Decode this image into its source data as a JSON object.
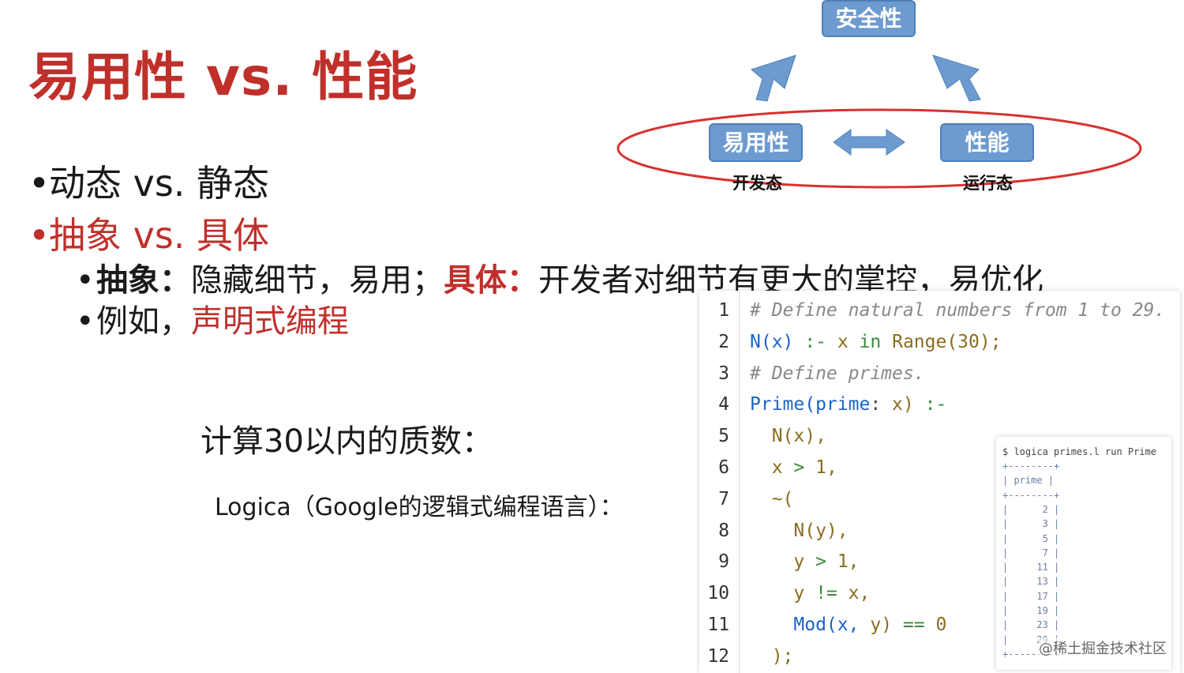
{
  "title": "易用性 vs. 性能",
  "bullets": {
    "b1": "动态 vs. 静态",
    "b2": "抽象 vs. 具体",
    "b3_label1": "抽象：",
    "b3_text1": "隐藏细节，易用；",
    "b3_label2": "具体：",
    "b3_text2": "开发者对细节有更大的掌控，易优化",
    "b4_text": "例如，",
    "b4_red": "声明式编程"
  },
  "calc_text": "计算30以内的质数：",
  "logica_text": "Logica（Google的逻辑式编程语言）：",
  "diagram": {
    "top_node": "安全性",
    "left_node": "易用性",
    "right_node": "性能",
    "left_state": "开发态",
    "right_state": "运行态",
    "node_color": "#6d9bd0",
    "ellipse_color": "#d8322e"
  },
  "code": {
    "lines": [
      {
        "n": "1",
        "segs": [
          [
            "cm",
            "# Define natural numbers from 1 to 29."
          ]
        ]
      },
      {
        "n": "2",
        "segs": [
          [
            "fn",
            "N(x)"
          ],
          [
            "",
            " "
          ],
          [
            "op",
            ":-"
          ],
          [
            "",
            " "
          ],
          [
            "vr",
            "x"
          ],
          [
            "",
            " "
          ],
          [
            "op",
            "in"
          ],
          [
            "",
            " "
          ],
          [
            "vr",
            "Range(30);"
          ]
        ]
      },
      {
        "n": "3",
        "segs": [
          [
            "cm",
            "# Define primes."
          ]
        ]
      },
      {
        "n": "4",
        "segs": [
          [
            "fn",
            "Prime(prime"
          ],
          [
            "",
            ": "
          ],
          [
            "vr",
            "x)"
          ],
          [
            "",
            " "
          ],
          [
            "op",
            ":-"
          ]
        ]
      },
      {
        "n": "5",
        "segs": [
          [
            "",
            "  "
          ],
          [
            "vr",
            "N(x),"
          ]
        ]
      },
      {
        "n": "6",
        "segs": [
          [
            "",
            "  "
          ],
          [
            "vr",
            "x"
          ],
          [
            "",
            " "
          ],
          [
            "op",
            ">"
          ],
          [
            "",
            " "
          ],
          [
            "vr",
            "1,"
          ]
        ]
      },
      {
        "n": "7",
        "segs": [
          [
            "",
            "  "
          ],
          [
            "vr",
            "~("
          ]
        ]
      },
      {
        "n": "8",
        "segs": [
          [
            "",
            "    "
          ],
          [
            "vr",
            "N(y),"
          ]
        ]
      },
      {
        "n": "9",
        "segs": [
          [
            "",
            "    "
          ],
          [
            "vr",
            "y"
          ],
          [
            "",
            " "
          ],
          [
            "op",
            ">"
          ],
          [
            "",
            " "
          ],
          [
            "vr",
            "1,"
          ]
        ]
      },
      {
        "n": "10",
        "segs": [
          [
            "",
            "    "
          ],
          [
            "vr",
            "y"
          ],
          [
            "",
            " "
          ],
          [
            "op",
            "!="
          ],
          [
            "",
            " "
          ],
          [
            "vr",
            "x,"
          ]
        ]
      },
      {
        "n": "11",
        "segs": [
          [
            "",
            "    "
          ],
          [
            "fn",
            "Mod(x,"
          ],
          [
            "",
            " "
          ],
          [
            "vr",
            "y)"
          ],
          [
            "",
            " "
          ],
          [
            "op",
            "=="
          ],
          [
            "",
            " "
          ],
          [
            "vr",
            "0"
          ]
        ]
      },
      {
        "n": "12",
        "segs": [
          [
            "",
            "  "
          ],
          [
            "vr",
            ");"
          ]
        ]
      }
    ]
  },
  "output": {
    "command": "$ logica primes.l run Prime",
    "border": "+--------+",
    "header": "| prime |",
    "rows": [
      "|      2 |",
      "|      3 |",
      "|      5 |",
      "|      7 |",
      "|     11 |",
      "|     13 |",
      "|     17 |",
      "|     19 |",
      "|     23 |",
      "|     29 |"
    ]
  },
  "watermark": "@稀土掘金技术社区"
}
